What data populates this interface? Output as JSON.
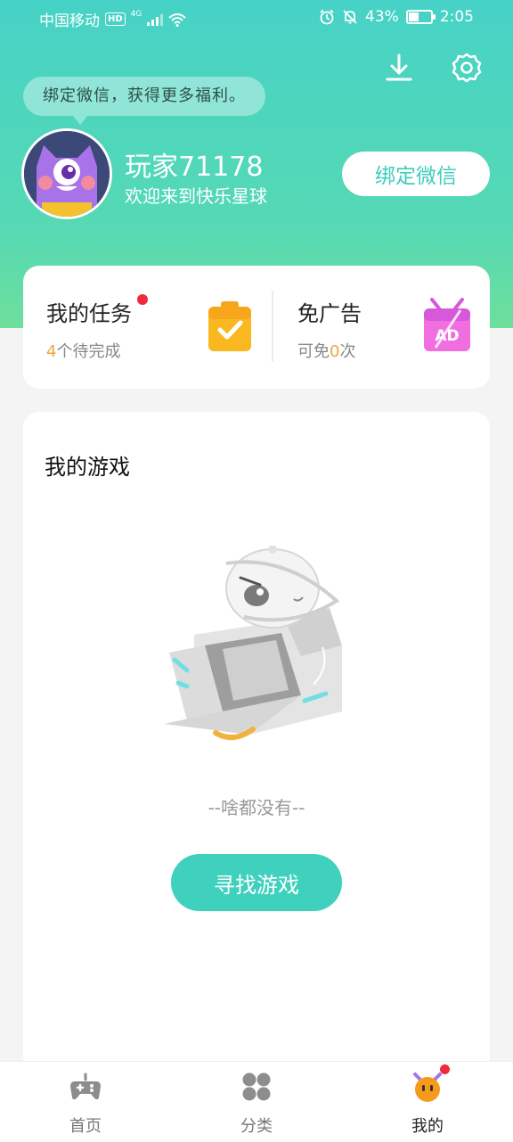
{
  "status_bar": {
    "carrier": "中国移动",
    "hd": "HD",
    "network": "4G",
    "battery": "43%",
    "time": "2:05"
  },
  "header": {
    "tip": "绑定微信，获得更多福利。",
    "username": "玩家71178",
    "welcome": "欢迎来到快乐星球",
    "bind_button": "绑定微信",
    "icons": [
      "download-icon",
      "settings-icon"
    ]
  },
  "task_card": {
    "tasks_title": "我的任务",
    "tasks_count": "4",
    "tasks_suffix": "个待完成",
    "ad_title": "免广告",
    "ad_prefix": "可免",
    "ad_count": "0",
    "ad_suffix": "次",
    "ad_icon_text": "AD"
  },
  "games": {
    "title": "我的游戏",
    "empty_text": "--啥都没有--",
    "find_button": "寻找游戏"
  },
  "bottom_nav": {
    "items": [
      {
        "label": "首页",
        "icon": "gamepad-icon",
        "active": false
      },
      {
        "label": "分类",
        "icon": "category-icon",
        "active": false
      },
      {
        "label": "我的",
        "icon": "profile-icon",
        "active": true
      }
    ]
  },
  "colors": {
    "accent": "#3fd1bd",
    "header_top": "#46d2c6",
    "header_bottom": "#6ddf9c",
    "highlight": "#f3a33a",
    "badge": "#f02a3c"
  }
}
